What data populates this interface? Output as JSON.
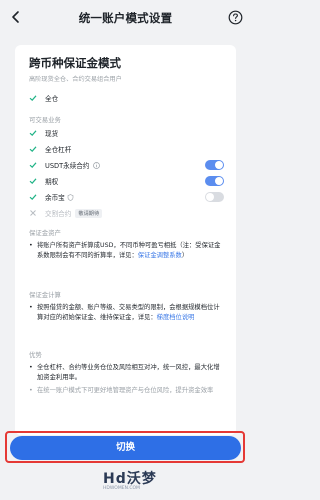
{
  "header": {
    "title": "统一账户模式设置"
  },
  "mode": {
    "title": "跨币种保证金模式",
    "subtitle": "高阶现货全仓、合约交易组合用户"
  },
  "margin": {
    "label": "全仓"
  },
  "business": {
    "section_label": "可交易业务",
    "items": [
      {
        "label": "现货"
      },
      {
        "label": "全仓杠杆"
      },
      {
        "label": "USDT永续合约",
        "toggle": "on"
      },
      {
        "label": "期权",
        "toggle": "on"
      },
      {
        "label": "余币宝",
        "toggle": "off"
      }
    ],
    "disabled_item": {
      "label": "交割合约",
      "tag": "敬请期待"
    }
  },
  "assets": {
    "section_label": "保证金资产",
    "text": "将账户所有资产折算成USD，不同币种可盈亏相抵（注：受保证金系数限制会有不同的折算率，详见：",
    "link": "保证金调整系数",
    "suffix": "）"
  },
  "calc": {
    "section_label": "保证金计算",
    "text": "按照借贷的金额、账户等级、交易类型的限制，会根据规模档位计算对应的初始保证金、维持保证金，详见：",
    "link": "梯度档位说明"
  },
  "advantages": {
    "section_label": "优势",
    "text": "全仓杠杆、合约等业务仓位及风险相互对冲，统一风控，最大化增加资金利用率。",
    "faded_text": "在统一账户模式下可更好地管理资产与仓位风险，提升资金效率"
  },
  "footer": {
    "switch_label": "切换"
  },
  "watermark": {
    "text": "Hd沃梦",
    "url": "HDWOMEN.COM"
  },
  "colors": {
    "accent": "#2e6fe6",
    "toggle_on": "#5b8def",
    "check": "#1fb386",
    "link": "#3a78e7",
    "highlight": "#e53935"
  }
}
